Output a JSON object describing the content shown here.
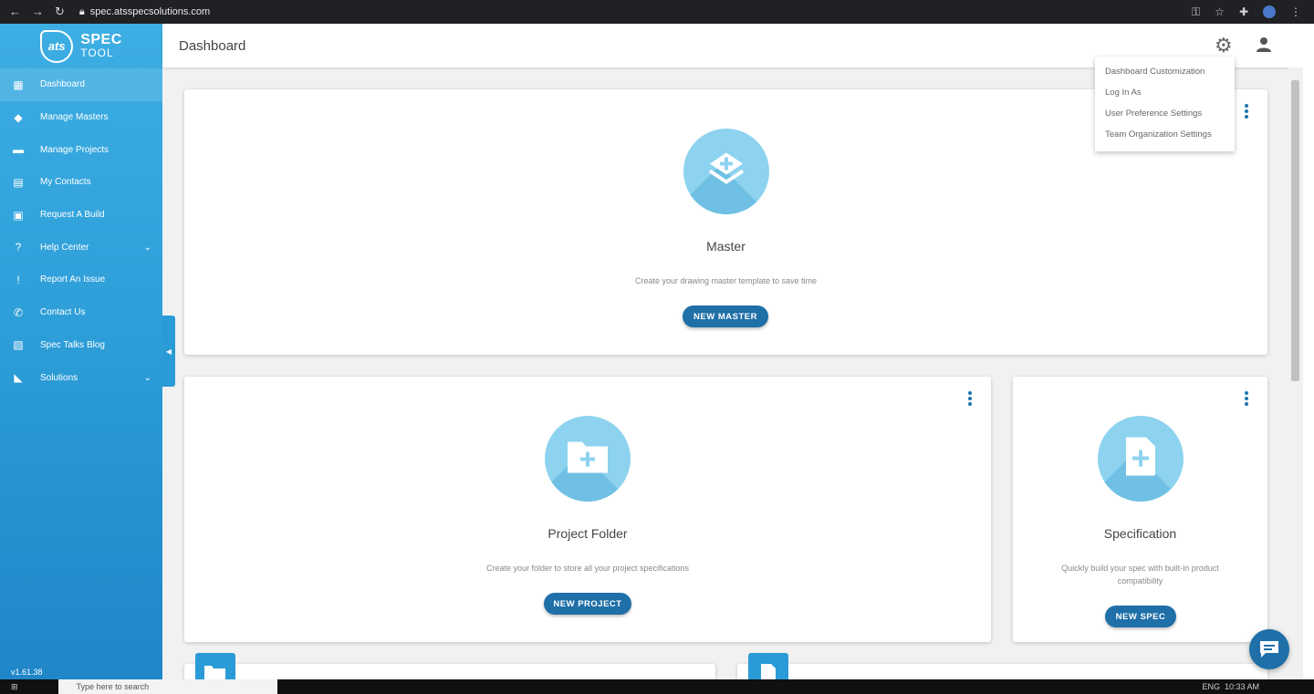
{
  "browser": {
    "url": "spec.atsspecsolutions.com"
  },
  "brand": {
    "mark": "ats",
    "line1": "SPEC",
    "line2": "TOOL"
  },
  "sidebar": {
    "items": [
      {
        "label": "Dashboard",
        "icon": "dashboard-icon",
        "glyph": "▦"
      },
      {
        "label": "Manage Masters",
        "icon": "layers-icon",
        "glyph": "◆"
      },
      {
        "label": "Manage Projects",
        "icon": "folder-icon",
        "glyph": "▬"
      },
      {
        "label": "My Contacts",
        "icon": "contacts-icon",
        "glyph": "▤"
      },
      {
        "label": "Request A Build",
        "icon": "clipboard-icon",
        "glyph": "▣"
      },
      {
        "label": "Help Center",
        "icon": "help-icon",
        "glyph": "?"
      },
      {
        "label": "Report An Issue",
        "icon": "alert-icon",
        "glyph": "!"
      },
      {
        "label": "Contact Us",
        "icon": "phone-icon",
        "glyph": "✆"
      },
      {
        "label": "Spec Talks Blog",
        "icon": "blog-icon",
        "glyph": "▧"
      },
      {
        "label": "Solutions",
        "icon": "tag-icon",
        "glyph": "◣"
      }
    ],
    "version": "v1.61.38"
  },
  "header": {
    "title": "Dashboard"
  },
  "dropdown": {
    "items": [
      "Dashboard Customization",
      "Log In As",
      "User Preference Settings",
      "Team Organization Settings"
    ]
  },
  "cards": {
    "master": {
      "title": "Master",
      "desc": "Create your drawing master template to save time",
      "button": "NEW MASTER"
    },
    "project": {
      "title": "Project Folder",
      "desc": "Create your folder to store all your project specifications",
      "button": "NEW PROJECT"
    },
    "spec": {
      "title": "Specification",
      "desc": "Quickly build your spec with built-in product compatibility",
      "button": "NEW SPEC"
    }
  },
  "taskbar": {
    "search_placeholder": "Type here to search",
    "time": "10:33 AM",
    "lang": "ENG"
  },
  "colors": {
    "accent": "#1f6fa8",
    "sidebar": "#2a9bd6",
    "icon_circle": "#8dd3ef"
  }
}
